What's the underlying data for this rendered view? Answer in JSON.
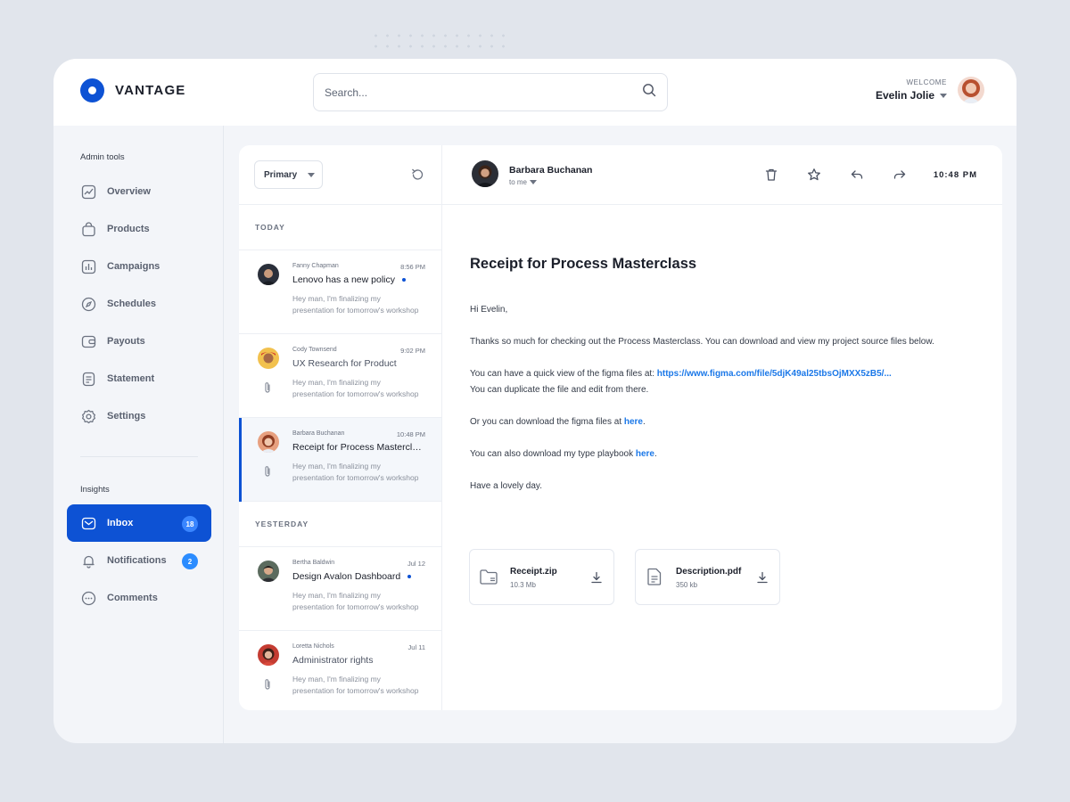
{
  "brand": {
    "name": "VANTAGE",
    "accent": "#0d52d4"
  },
  "search": {
    "placeholder": "Search...",
    "icon": "search-icon"
  },
  "user": {
    "welcome": "WELCOME",
    "name": "Evelin Jolie"
  },
  "sidebar": {
    "admin_label": "Admin tools",
    "admin_items": [
      {
        "label": "Overview",
        "icon": "chart-line-icon"
      },
      {
        "label": "Products",
        "icon": "shopping-bag-icon"
      },
      {
        "label": "Campaigns",
        "icon": "bar-chart-icon"
      },
      {
        "label": "Schedules",
        "icon": "compass-icon"
      },
      {
        "label": "Payouts",
        "icon": "wallet-icon"
      },
      {
        "label": "Statement",
        "icon": "document-icon"
      },
      {
        "label": "Settings",
        "icon": "gear-icon"
      }
    ],
    "insights_label": "Insights",
    "insight_items": [
      {
        "label": "Inbox",
        "icon": "inbox-icon",
        "badge": "18",
        "active": true
      },
      {
        "label": "Notifications",
        "icon": "bell-icon",
        "badge": "2"
      },
      {
        "label": "Comments",
        "icon": "chat-icon"
      }
    ]
  },
  "mail_list": {
    "filter": "Primary",
    "groups": [
      {
        "label": "TODAY",
        "mails": [
          {
            "sender": "Fanny Chapman",
            "time": "8:56 PM",
            "subject": "Lenovo has a new policy",
            "unread": true,
            "preview": [
              "Hey man, I'm finalizing my",
              "presentation for tomorrow's workshop"
            ],
            "attachment": false
          },
          {
            "sender": "Cody Townsend",
            "time": "9:02 PM",
            "subject": "UX Research for Product",
            "unread": false,
            "preview": [
              "Hey man, I'm finalizing my",
              "presentation for tomorrow's workshop"
            ],
            "attachment": true
          },
          {
            "sender": "Barbara Buchanan",
            "time": "10:48 PM",
            "subject": "Receipt for Process Masterclass",
            "unread": false,
            "selected": true,
            "preview": [
              "Hey man, I'm finalizing my",
              "presentation for tomorrow's workshop"
            ],
            "attachment": true
          }
        ]
      },
      {
        "label": "YESTERDAY",
        "mails": [
          {
            "sender": "Bertha Baldwin",
            "time": "Jul 12",
            "subject": "Design Avalon Dashboard",
            "unread": true,
            "preview": [
              "Hey man, I'm finalizing my",
              "presentation for tomorrow's workshop"
            ],
            "attachment": false
          },
          {
            "sender": "Loretta Nichols",
            "time": "Jul 11",
            "subject": "Administrator rights",
            "unread": false,
            "preview": [
              "Hey man, I'm finalizing my",
              "presentation for tomorrow's workshop"
            ],
            "attachment": true
          }
        ]
      }
    ]
  },
  "reader": {
    "from": "Barbara Buchanan",
    "to": "to me",
    "time": "10:48 PM",
    "title": "Receipt for Process Masterclass",
    "greeting": "Hi Evelin,",
    "p1": "Thanks so much for checking out the Process Masterclass. You can download and view my project source files below.",
    "p2_text": "You can have a quick view of the figma files at: ",
    "p2_link": "https://www.figma.com/file/5djK49al25tbsOjMXX5zB5/...",
    "p3": "You can duplicate the file and edit from there.",
    "p4_text": "Or you can download the figma files at ",
    "p4_link": "here",
    "p4_end": ".",
    "p5_text": "You can also download my type playbook ",
    "p5_link": "here",
    "p5_end": ".",
    "closing": "Have a lovely day.",
    "attachments": [
      {
        "name": "Receipt.zip",
        "size": "10.3 Mb",
        "icon": "folder-icon"
      },
      {
        "name": "Description.pdf",
        "size": "350 kb",
        "icon": "file-icon"
      }
    ]
  }
}
